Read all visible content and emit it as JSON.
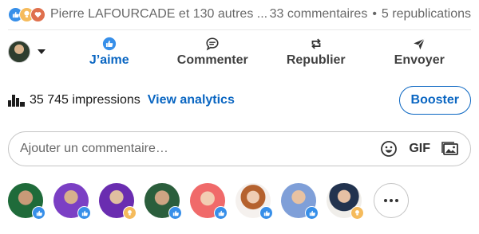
{
  "social": {
    "reaction_icons": [
      "like-icon",
      "insightful-icon",
      "love-icon"
    ],
    "reactors_text": "Pierre LAFOURCADE et 130 autres ...",
    "comments_text": "33 commentaires",
    "separator": "•",
    "reposts_text": "5 republications"
  },
  "actions": {
    "like": {
      "label": "J’aime",
      "icon": "thumbs-up-icon",
      "active": true
    },
    "comment": {
      "label": "Commenter",
      "icon": "comment-icon"
    },
    "repost": {
      "label": "Republier",
      "icon": "repost-icon"
    },
    "send": {
      "label": "Envoyer",
      "icon": "send-icon"
    }
  },
  "stats": {
    "impressions_text": "35 745 impressions",
    "analytics_link": "View analytics",
    "boost_button": "Booster"
  },
  "comment_box": {
    "placeholder": "Ajouter un commentaire…",
    "gif_label": "GIF"
  },
  "reactors": [
    {
      "reaction": "like"
    },
    {
      "reaction": "like"
    },
    {
      "reaction": "insightful"
    },
    {
      "reaction": "like"
    },
    {
      "reaction": "like"
    },
    {
      "reaction": "like"
    },
    {
      "reaction": "like"
    },
    {
      "reaction": "insightful"
    }
  ],
  "colors": {
    "brand_blue": "#0a66c2",
    "like_blue": "#378fe9",
    "insight_yellow": "#f5bb5c",
    "love_red": "#df704d"
  }
}
